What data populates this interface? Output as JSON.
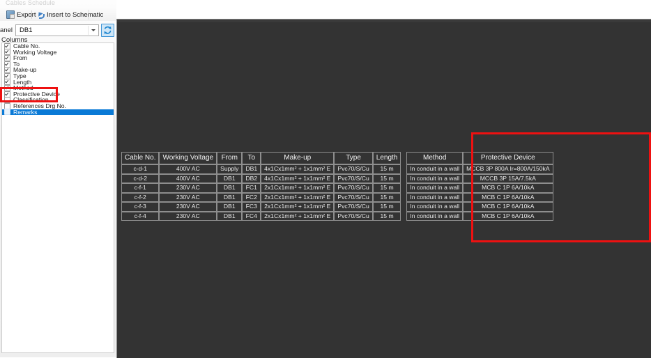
{
  "window": {
    "title": "Cables Schedule"
  },
  "toolbar": {
    "export_label": "Export",
    "export_icon": "export-icon",
    "insert_label": "Insert to Schematic",
    "insert_icon": "insert-arrow-icon"
  },
  "panel_selector": {
    "label": "anel",
    "value": "DB1",
    "dropdown_icon": "chevron-down-icon",
    "refresh_icon": "refresh-icon"
  },
  "columns_panel": {
    "label": "Columns",
    "items": [
      {
        "label": "Cable No.",
        "checked": true,
        "selected": false
      },
      {
        "label": "Working Voltage",
        "checked": true,
        "selected": false
      },
      {
        "label": "From",
        "checked": true,
        "selected": false
      },
      {
        "label": "To",
        "checked": true,
        "selected": false
      },
      {
        "label": "Make-up",
        "checked": true,
        "selected": false
      },
      {
        "label": "Type",
        "checked": true,
        "selected": false
      },
      {
        "label": "Length",
        "checked": true,
        "selected": false
      },
      {
        "label": "Method",
        "checked": true,
        "selected": false
      },
      {
        "label": "Protective Device",
        "checked": true,
        "selected": false
      },
      {
        "label": "Classification",
        "checked": false,
        "selected": false
      },
      {
        "label": "References Drg No.",
        "checked": false,
        "selected": false
      },
      {
        "label": "Remarks",
        "checked": false,
        "selected": true
      }
    ]
  },
  "table": {
    "headers": [
      "Cable No.",
      "Working Voltage",
      "From",
      "To",
      "Make-up",
      "Type",
      "Length",
      "Method",
      "Protective Device"
    ],
    "rows": [
      [
        "c-d-1",
        "400V AC",
        "Supply",
        "DB1",
        "4x1Cx1mm² + 1x1mm² E",
        "Pvc70/S/Cu",
        "15 m",
        "In conduit in a wall",
        "MCCB 3P 800A Ir=800A/150kA"
      ],
      [
        "c-d-2",
        "400V AC",
        "DB1",
        "DB2",
        "4x1Cx1mm² + 1x1mm² E",
        "Pvc70/S/Cu",
        "15 m",
        "In conduit in a wall",
        "MCCB 3P  15A/7.5kA"
      ],
      [
        "c-f-1",
        "230V AC",
        "DB1",
        "FC1",
        "2x1Cx1mm² + 1x1mm² E",
        "Pvc70/S/Cu",
        "15 m",
        "In conduit in a wall",
        "MCB C 1P  6A/10kA"
      ],
      [
        "c-f-2",
        "230V AC",
        "DB1",
        "FC2",
        "2x1Cx1mm² + 1x1mm² E",
        "Pvc70/S/Cu",
        "15 m",
        "In conduit in a wall",
        "MCB C 1P  6A/10kA"
      ],
      [
        "c-f-3",
        "230V AC",
        "DB1",
        "FC3",
        "2x1Cx1mm² + 1x1mm² E",
        "Pvc70/S/Cu",
        "15 m",
        "In conduit in a wall",
        "MCB C 1P  6A/10kA"
      ],
      [
        "c-f-4",
        "230V AC",
        "DB1",
        "FC4",
        "2x1Cx1mm² + 1x1mm² E",
        "Pvc70/S/Cu",
        "15 m",
        "In conduit in a wall",
        "MCB C 1P  6A/10kA"
      ]
    ]
  },
  "annotations": {
    "sidebar_highlight": "red-rectangle-highlight",
    "table_highlight": "red-rectangle-highlight"
  },
  "colors": {
    "annotation_red": "#ee1111",
    "selection_blue": "#0a7ad6",
    "canvas_dark": "#333333",
    "accent_blue": "#3c93d6"
  }
}
